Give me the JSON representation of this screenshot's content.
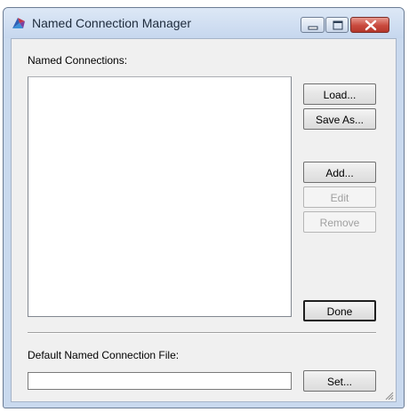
{
  "window": {
    "title": "Named Connection Manager",
    "title_icon": "app-logo-icon",
    "controls": [
      "minimize-icon",
      "maximize-icon",
      "close-icon"
    ]
  },
  "connections": {
    "label": "Named Connections:",
    "items": []
  },
  "buttons": {
    "load": "Load...",
    "save_as": "Save As...",
    "add": "Add...",
    "edit": "Edit",
    "remove": "Remove",
    "done": "Done",
    "set": "Set..."
  },
  "default_file": {
    "label": "Default Named Connection File:",
    "value": ""
  },
  "colors": {
    "title_bar": "#c6d7ee",
    "close_button": "#c94a3e",
    "dialog_background": "#f0f0f0",
    "disabled_text": "#a0a0a0"
  }
}
